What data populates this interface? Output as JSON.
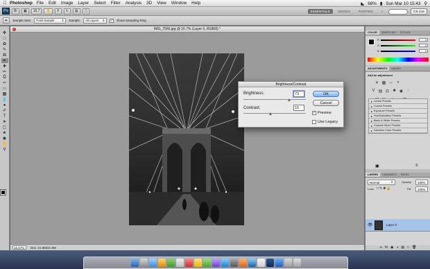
{
  "menubar": {
    "app_name": "Photoshop",
    "items": [
      "File",
      "Edit",
      "Image",
      "Layer",
      "Select",
      "Filter",
      "Analysis",
      "3D",
      "View",
      "Window",
      "Help"
    ],
    "battery": "68%",
    "clock": "Sun Mar 10  15:43"
  },
  "appbar": {
    "logo": "Ps",
    "zoom": "16.7",
    "workspaces": [
      "ESSENTIALS",
      "DESIGN",
      "PAINTING",
      "»"
    ],
    "cs_live": "CS Live"
  },
  "options": {
    "sample_size_label": "Sample Size:",
    "sample_size_value": "Point Sample",
    "sample_label": "Sample:",
    "sample_value": "All Layers",
    "show_ring_label": "Show Sampling Ring"
  },
  "document": {
    "title": "IMG_7566.jpg @ 16.7% (Layer 0, RGB/8) *",
    "zoom": "16.67%",
    "doc_size": "Doc: 21.9M/21.9M"
  },
  "dialog": {
    "title": "Brightness/Contrast",
    "brightness_label": "Brightness:",
    "brightness_value": "73",
    "contrast_label": "Contrast:",
    "contrast_value": "15",
    "ok_label": "OK",
    "cancel_label": "Cancel",
    "preview_label": "Preview",
    "preview_checked": true,
    "legacy_label": "Use Legacy",
    "legacy_checked": false
  },
  "panels": {
    "color_tabs": [
      "COLOR",
      "SWATCHES",
      "STYLES"
    ],
    "color_channels": [
      {
        "label": "R",
        "value": "0"
      },
      {
        "label": "G",
        "value": "0"
      },
      {
        "label": "B",
        "value": "0"
      }
    ],
    "adjust_tabs": [
      "ADJUSTMENTS",
      "MASKS"
    ],
    "adjust_heading": "Add an adjustment",
    "presets": [
      "Levels Presets",
      "Curves Presets",
      "Exposure Presets",
      "Hue/Saturation Presets",
      "Black & White Presets",
      "Channel Mixer Presets",
      "Selective Color Presets"
    ],
    "layer_tabs": [
      "LAYERS",
      "CHANNELS",
      "PATHS"
    ],
    "blend_mode": "Normal",
    "opacity_label": "Opacity:",
    "opacity_value": "100%",
    "lock_label": "Lock:",
    "fill_label": "Fill:",
    "fill_value": "100%",
    "layer_name": "Layer 0"
  }
}
